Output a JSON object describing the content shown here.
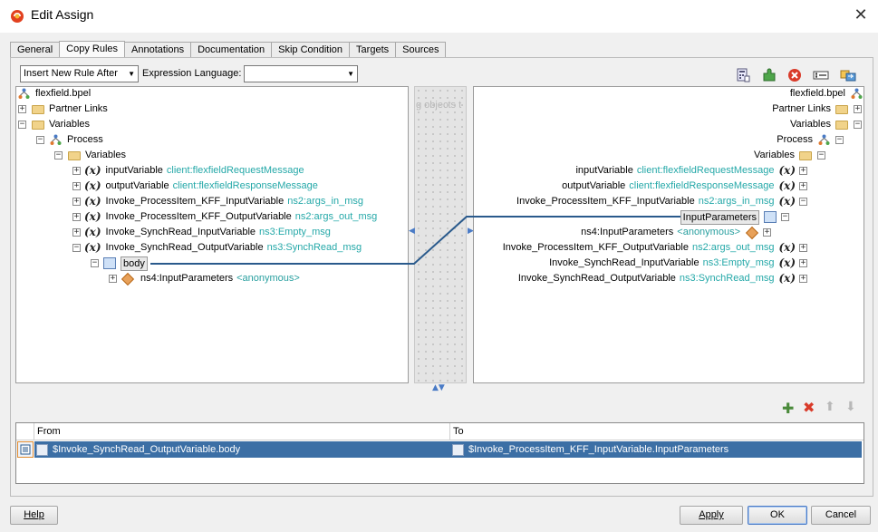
{
  "window": {
    "title": "Edit Assign",
    "close_label": "✕"
  },
  "tabs": [
    {
      "label": "General"
    },
    {
      "label": "Copy Rules",
      "active": true
    },
    {
      "label": "Annotations"
    },
    {
      "label": "Documentation"
    },
    {
      "label": "Skip Condition"
    },
    {
      "label": "Targets"
    },
    {
      "label": "Sources"
    }
  ],
  "toolbar": {
    "insert_rule_select": "Insert New Rule After",
    "expression_language_label": "Expression Language:",
    "expression_language_value": "",
    "icons": [
      "calculator-icon",
      "puzzle-icon",
      "delete-circle-icon",
      "text-field-icon",
      "swap-icon"
    ]
  },
  "left_tree": {
    "root": "flexfield.bpel",
    "partner_links": "Partner Links",
    "variables": "Variables",
    "process": "Process",
    "process_variables": "Variables",
    "items": [
      {
        "name": "inputVariable",
        "type": "client:flexfieldRequestMessage"
      },
      {
        "name": "outputVariable",
        "type": "client:flexfieldResponseMessage"
      },
      {
        "name": "Invoke_ProcessItem_KFF_InputVariable",
        "type": "ns2:args_in_msg"
      },
      {
        "name": "Invoke_ProcessItem_KFF_OutputVariable",
        "type": "ns2:args_out_msg"
      },
      {
        "name": "Invoke_SynchRead_InputVariable",
        "type": "ns3:Empty_msg"
      },
      {
        "name": "Invoke_SynchRead_OutputVariable",
        "type": "ns3:SynchRead_msg"
      }
    ],
    "body": "body",
    "body_child": {
      "name": "ns4:InputParameters",
      "type": "<anonymous>"
    }
  },
  "middle": {
    "watermark": "g objects t"
  },
  "right_tree": {
    "root": "flexfield.bpel",
    "partner_links": "Partner Links",
    "variables": "Variables",
    "process": "Process",
    "process_variables": "Variables",
    "items_before": [
      {
        "name": "inputVariable",
        "type": "client:flexfieldRequestMessage"
      },
      {
        "name": "outputVariable",
        "type": "client:flexfieldResponseMessage"
      },
      {
        "name": "Invoke_ProcessItem_KFF_InputVariable",
        "type": "ns2:args_in_msg"
      }
    ],
    "input_parameters": "InputParameters",
    "input_params_child": {
      "name": "ns4:InputParameters",
      "type": "<anonymous>"
    },
    "items_after": [
      {
        "name": "Invoke_ProcessItem_KFF_OutputVariable",
        "type": "ns2:args_out_msg"
      },
      {
        "name": "Invoke_SynchRead_InputVariable",
        "type": "ns3:Empty_msg"
      },
      {
        "name": "Invoke_SynchRead_OutputVariable",
        "type": "ns3:SynchRead_msg"
      }
    ]
  },
  "rules_table": {
    "headers": {
      "from": "From",
      "to": "To"
    },
    "rows": [
      {
        "from": "$Invoke_SynchRead_OutputVariable.body",
        "to": "$Invoke_ProcessItem_KFF_InputVariable.InputParameters"
      }
    ]
  },
  "buttons": {
    "help": "Help",
    "apply": "Apply",
    "ok": "OK",
    "cancel": "Cancel"
  },
  "colors": {
    "link_line": "#2a5a8c",
    "type_text": "#24a8a8",
    "selection": "#3c6fa5"
  }
}
